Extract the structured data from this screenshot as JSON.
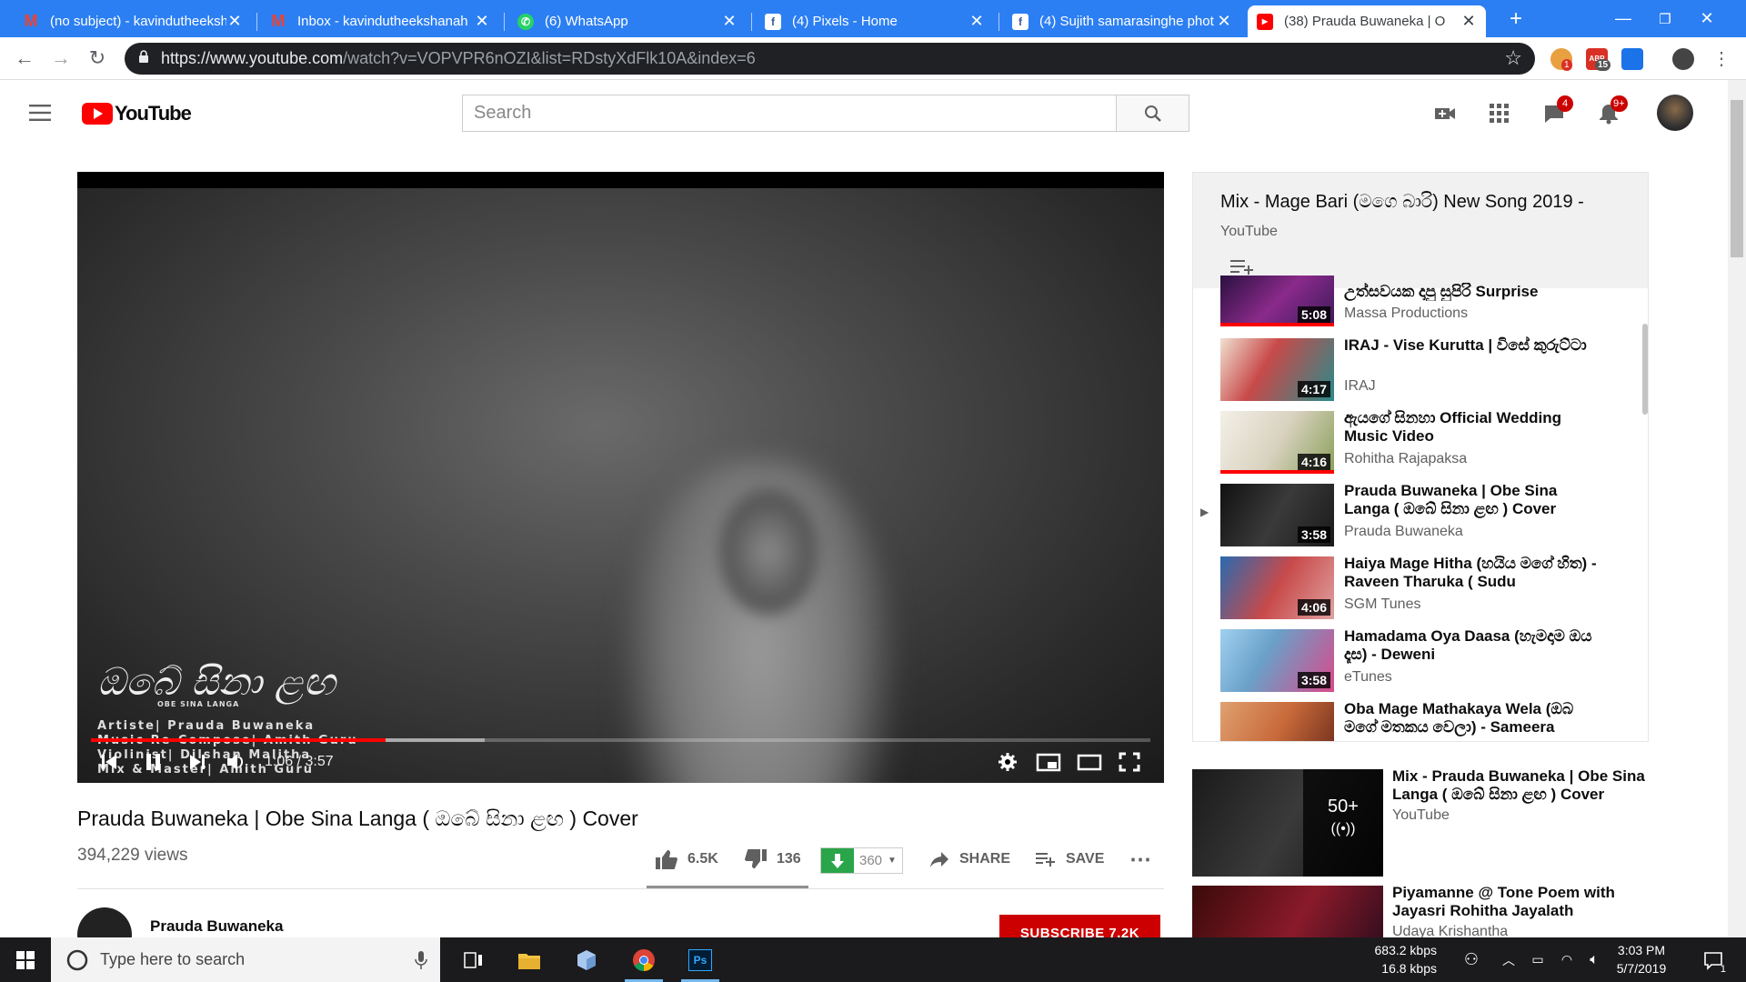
{
  "browser": {
    "tabs": [
      {
        "title": "(no subject) - kavindutheeksh",
        "icon": "gmail-icon"
      },
      {
        "title": "Inbox - kavindutheekshanah",
        "icon": "gmail-icon"
      },
      {
        "title": "(6) WhatsApp",
        "icon": "whatsapp-icon"
      },
      {
        "title": "(4) Pixels - Home",
        "icon": "facebook-icon"
      },
      {
        "title": "(4) Sujith samarasinghe phot",
        "icon": "facebook-icon"
      },
      {
        "title": "(38) Prauda Buwaneka | O",
        "icon": "youtube-icon"
      }
    ],
    "url_host": "https://www.youtube.com",
    "url_path": "/watch?v=VOPVPR6nOZI&list=RDstyXdFlk10A&index=6",
    "ext_badges": [
      "1",
      "ABP",
      "15"
    ]
  },
  "youtube": {
    "logo_text": "YouTube",
    "search_placeholder": "Search",
    "chat_badge": "4",
    "notif_badge": "9+"
  },
  "player": {
    "credit_title": "ඔබේ සිනා ළඟ",
    "credit_sub": "OBE SINA LANGA",
    "credits": [
      "Artiste|  Prauda  Buwaneka",
      "Music  Re-Compose|  Amith  Guru",
      "Violinist|  Dilshan  Malitha",
      "Mix  &  Master|  Amith  Guru"
    ],
    "time": "1:06 / 3:57",
    "progress": 0.278,
    "buffered": 0.372
  },
  "video": {
    "title": "Prauda Buwaneka | Obe Sina Langa ( ඔබේ සිනා ළඟ ) Cover",
    "views": "394,229 views",
    "likes": "6.5K",
    "dislikes": "136",
    "download_count": "360",
    "share": "SHARE",
    "save": "SAVE",
    "channel": "Prauda Buwaneka",
    "subscribe": "SUBSCRIBE 7.2K"
  },
  "playlist": {
    "title": "Mix - Mage Bari (මගෙ බාරි) New Song 2019 -",
    "subtitle": "YouTube",
    "items": [
      {
        "title": "උත්සවයක දාපු සුපිරි Surprise",
        "channel": "Massa Productions",
        "duration": "5:08",
        "color": "#6a1a6a"
      },
      {
        "title": "IRAJ - Vise Kurutta | විසේ කුරුට්ටා",
        "channel": "IRAJ",
        "duration": "4:17",
        "color": "#c84a4a"
      },
      {
        "title": "ඇයගේ සිනහා Official Wedding Music Video",
        "channel": "Rohitha Rajapaksa",
        "duration": "4:16",
        "color": "#d9d2c0"
      },
      {
        "title": "Prauda Buwaneka | Obe Sina Langa ( ඔබේ සිනා ළඟ ) Cover",
        "channel": "Prauda Buwaneka",
        "duration": "3:58",
        "color": "#2a2a2a"
      },
      {
        "title": "Haiya Mage Hitha (හයිය මගේ හිත) - Raveen Tharuka ( Sudu",
        "channel": "SGM Tunes",
        "duration": "4:06",
        "color": "#4a6fa0"
      },
      {
        "title": "Hamadama Oya Daasa (හැමදාම ඔය දෑස) - Deweni",
        "channel": "eTunes",
        "duration": "3:58",
        "color": "#6aa0c8"
      },
      {
        "title": "Oba Mage Mathakaya Wela (ඔබ මගේ මතකය වෙලා) - Sameera",
        "channel": "",
        "duration": "",
        "color": "#c86a3a"
      }
    ]
  },
  "recommendations": [
    {
      "title": "Mix - Prauda Buwaneka | Obe Sina Langa ( ඔබේ සිනා ළඟ ) Cover",
      "channel": "YouTube",
      "count": "50+"
    },
    {
      "title": "Piyamanne @ Tone Poem with Jayasri Rohitha Jayalath",
      "channel": "Udaya Krishantha"
    }
  ],
  "taskbar": {
    "search_placeholder": "Type here to search",
    "net_up": "683.2 kbps",
    "net_down": "16.8 kbps",
    "time": "3:03 PM",
    "date": "5/7/2019",
    "notif_count": "1"
  }
}
